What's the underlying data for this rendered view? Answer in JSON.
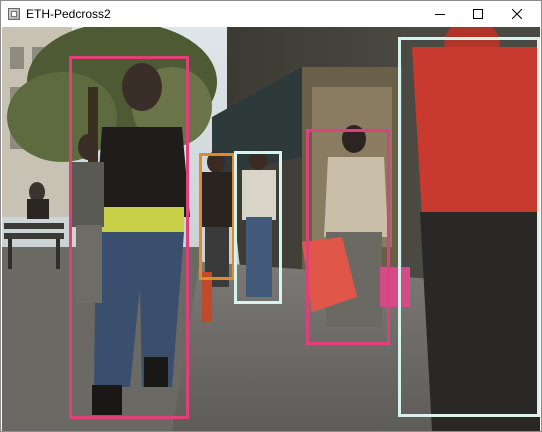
{
  "window": {
    "title": "ETH-Pedcross2",
    "controls": {
      "minimize": "minimize-icon",
      "maximize": "maximize-icon",
      "close": "close-icon"
    }
  },
  "detections": [
    {
      "color": "#e0407a"
    },
    {
      "color": "#e08a30"
    },
    {
      "color": "#d8f2ee"
    },
    {
      "color": "#e0407a"
    },
    {
      "color": "#d8f2ee"
    }
  ],
  "colors": {
    "pink_box": "#e0407a",
    "orange_box": "#e08a30",
    "cyan_box": "#d8f2ee",
    "titlebar": "#ffffff"
  }
}
